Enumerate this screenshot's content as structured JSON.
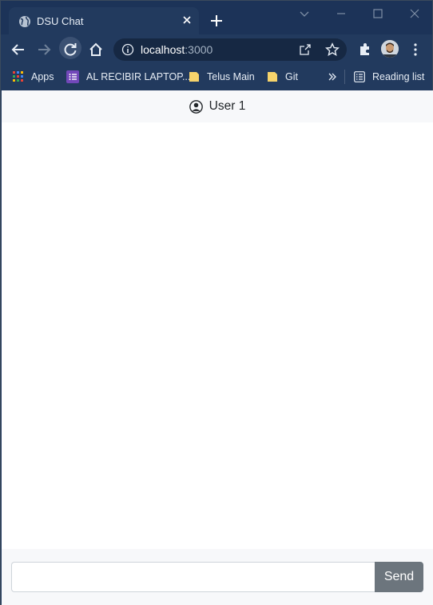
{
  "browser": {
    "tab": {
      "title": "DSU Chat"
    },
    "address": {
      "host": "localhost",
      "port": ":3000"
    },
    "bookmarks": [
      {
        "label": "Apps",
        "icon": "apps-grid-icon"
      },
      {
        "label": "AL RECIBIR LAPTOP...",
        "icon": "form-icon"
      },
      {
        "label": "Telus Main",
        "icon": "folder-icon"
      },
      {
        "label": "Git",
        "icon": "folder-icon"
      }
    ],
    "reading_list": "Reading list",
    "colors": {
      "frame": "#1c3358",
      "toolbar": "#223a5e",
      "omnibox": "#162843"
    }
  },
  "chat": {
    "header": {
      "user": "User 1",
      "icon": "user-circle-icon"
    },
    "input": {
      "value": "",
      "placeholder": ""
    },
    "send_label": "Send",
    "colors": {
      "header_bg": "#f7f8fa",
      "send_bg": "#6c757d"
    }
  }
}
